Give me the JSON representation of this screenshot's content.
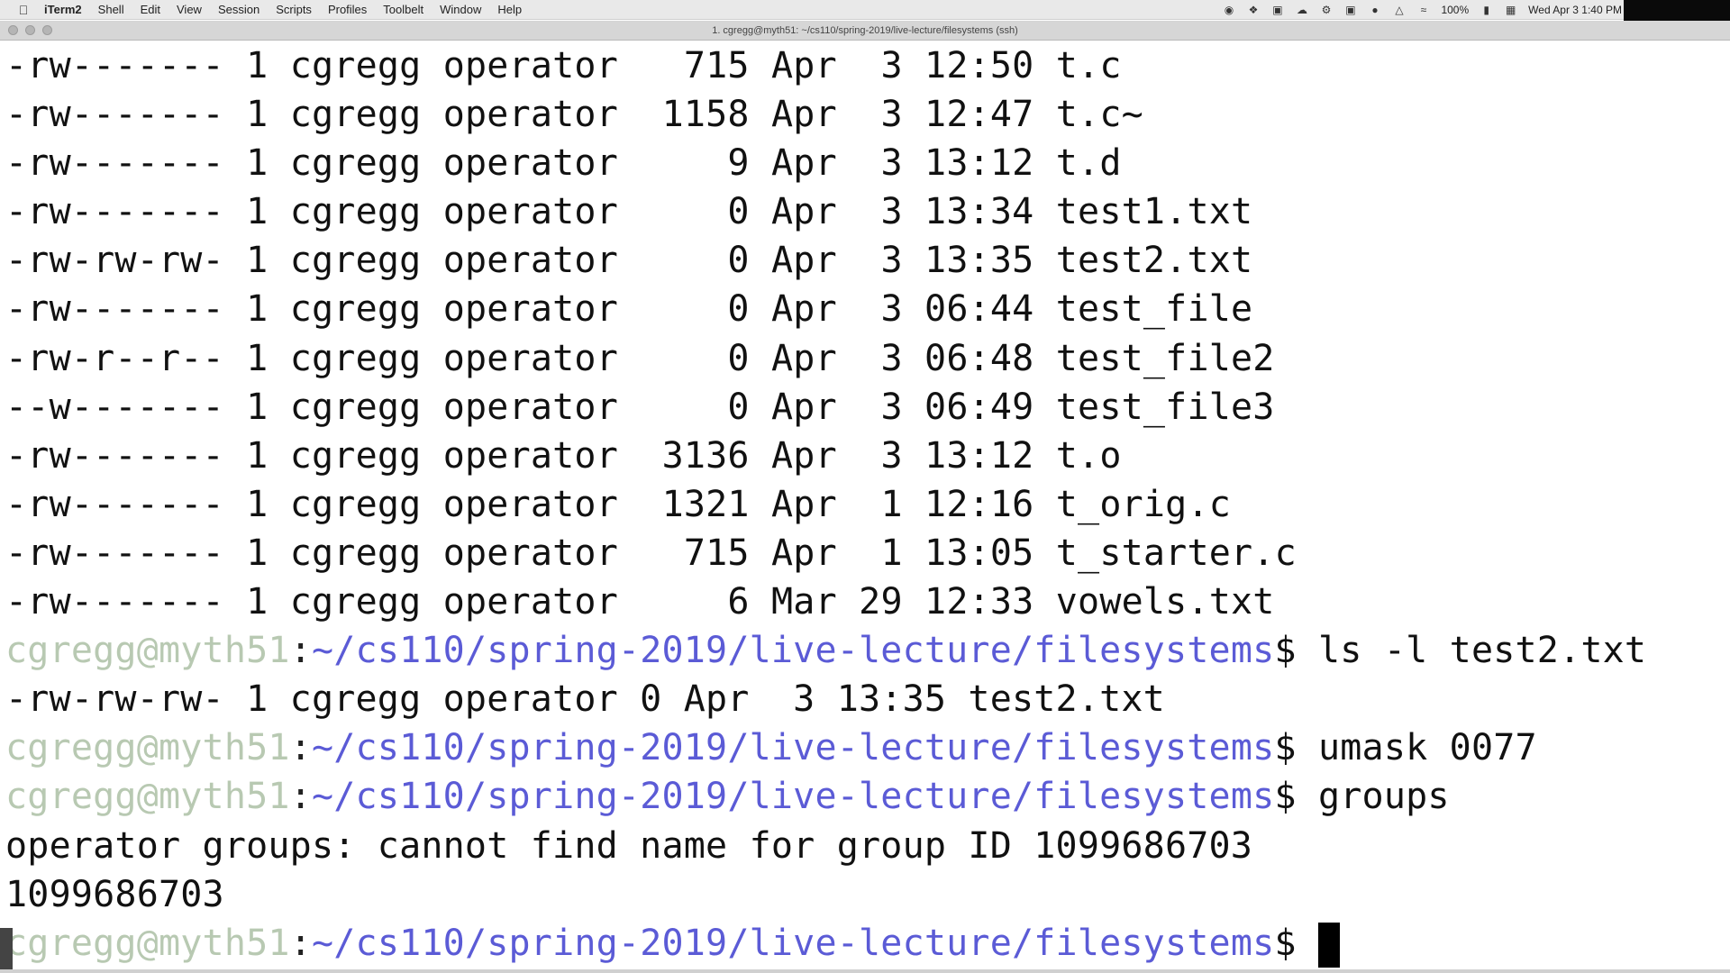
{
  "menubar": {
    "apple_icon": "apple-icon",
    "app_name": "iTerm2",
    "menus": [
      "Shell",
      "Edit",
      "View",
      "Session",
      "Scripts",
      "Profiles",
      "Toolbelt",
      "Window",
      "Help"
    ],
    "status_icons": [
      "record-icon",
      "dropbox-icon",
      "sync-icon",
      "cloud-icon",
      "settings-icon",
      "display-icon",
      "dot-icon",
      "airplay-icon",
      "wifi-icon"
    ],
    "battery": "100%",
    "datetime": "Wed Apr 3  1:40 PM"
  },
  "window": {
    "title": "1. cgregg@myth51: ~/cs110/spring-2019/live-lecture/filesystems (ssh)"
  },
  "terminal": {
    "listing": [
      {
        "perms": "-rw-------",
        "links": "1",
        "owner": "cgregg",
        "group": "operator",
        "size": "715",
        "month": "Apr",
        "day": "3",
        "time": "12:50",
        "name": "t.c"
      },
      {
        "perms": "-rw-------",
        "links": "1",
        "owner": "cgregg",
        "group": "operator",
        "size": "1158",
        "month": "Apr",
        "day": "3",
        "time": "12:47",
        "name": "t.c~"
      },
      {
        "perms": "-rw-------",
        "links": "1",
        "owner": "cgregg",
        "group": "operator",
        "size": "9",
        "month": "Apr",
        "day": "3",
        "time": "13:12",
        "name": "t.d"
      },
      {
        "perms": "-rw-------",
        "links": "1",
        "owner": "cgregg",
        "group": "operator",
        "size": "0",
        "month": "Apr",
        "day": "3",
        "time": "13:34",
        "name": "test1.txt"
      },
      {
        "perms": "-rw-rw-rw-",
        "links": "1",
        "owner": "cgregg",
        "group": "operator",
        "size": "0",
        "month": "Apr",
        "day": "3",
        "time": "13:35",
        "name": "test2.txt"
      },
      {
        "perms": "-rw-------",
        "links": "1",
        "owner": "cgregg",
        "group": "operator",
        "size": "0",
        "month": "Apr",
        "day": "3",
        "time": "06:44",
        "name": "test_file"
      },
      {
        "perms": "-rw-r--r--",
        "links": "1",
        "owner": "cgregg",
        "group": "operator",
        "size": "0",
        "month": "Apr",
        "day": "3",
        "time": "06:48",
        "name": "test_file2"
      },
      {
        "perms": "--w-------",
        "links": "1",
        "owner": "cgregg",
        "group": "operator",
        "size": "0",
        "month": "Apr",
        "day": "3",
        "time": "06:49",
        "name": "test_file3"
      },
      {
        "perms": "-rw-------",
        "links": "1",
        "owner": "cgregg",
        "group": "operator",
        "size": "3136",
        "month": "Apr",
        "day": "3",
        "time": "13:12",
        "name": "t.o"
      },
      {
        "perms": "-rw-------",
        "links": "1",
        "owner": "cgregg",
        "group": "operator",
        "size": "1321",
        "month": "Apr",
        "day": "1",
        "time": "12:16",
        "name": "t_orig.c"
      },
      {
        "perms": "-rw-------",
        "links": "1",
        "owner": "cgregg",
        "group": "operator",
        "size": "715",
        "month": "Apr",
        "day": "1",
        "time": "13:05",
        "name": "t_starter.c"
      },
      {
        "perms": "-rw-------",
        "links": "1",
        "owner": "cgregg",
        "group": "operator",
        "size": "6",
        "month": "Mar",
        "day": "29",
        "time": "12:33",
        "name": "vowels.txt"
      }
    ],
    "prompt_user": "cgregg@myth51",
    "prompt_colon": ":",
    "prompt_path": "~/cs110/spring-2019/live-lecture/filesystems",
    "prompt_dollar": "$",
    "cmd1": " ls -l test2.txt",
    "out1": "-rw-rw-rw- 1 cgregg operator 0 Apr  3 13:35 test2.txt",
    "cmd2": " umask 0077",
    "cmd3": " groups",
    "out3a": "operator groups: cannot find name for group ID 1099686703",
    "out3b": "1099686703",
    "cmd4": " "
  },
  "colors": {
    "prompt_user": "#b8c9b2",
    "prompt_path": "#5b5bd6",
    "text": "#111111",
    "background": "#ffffff"
  }
}
